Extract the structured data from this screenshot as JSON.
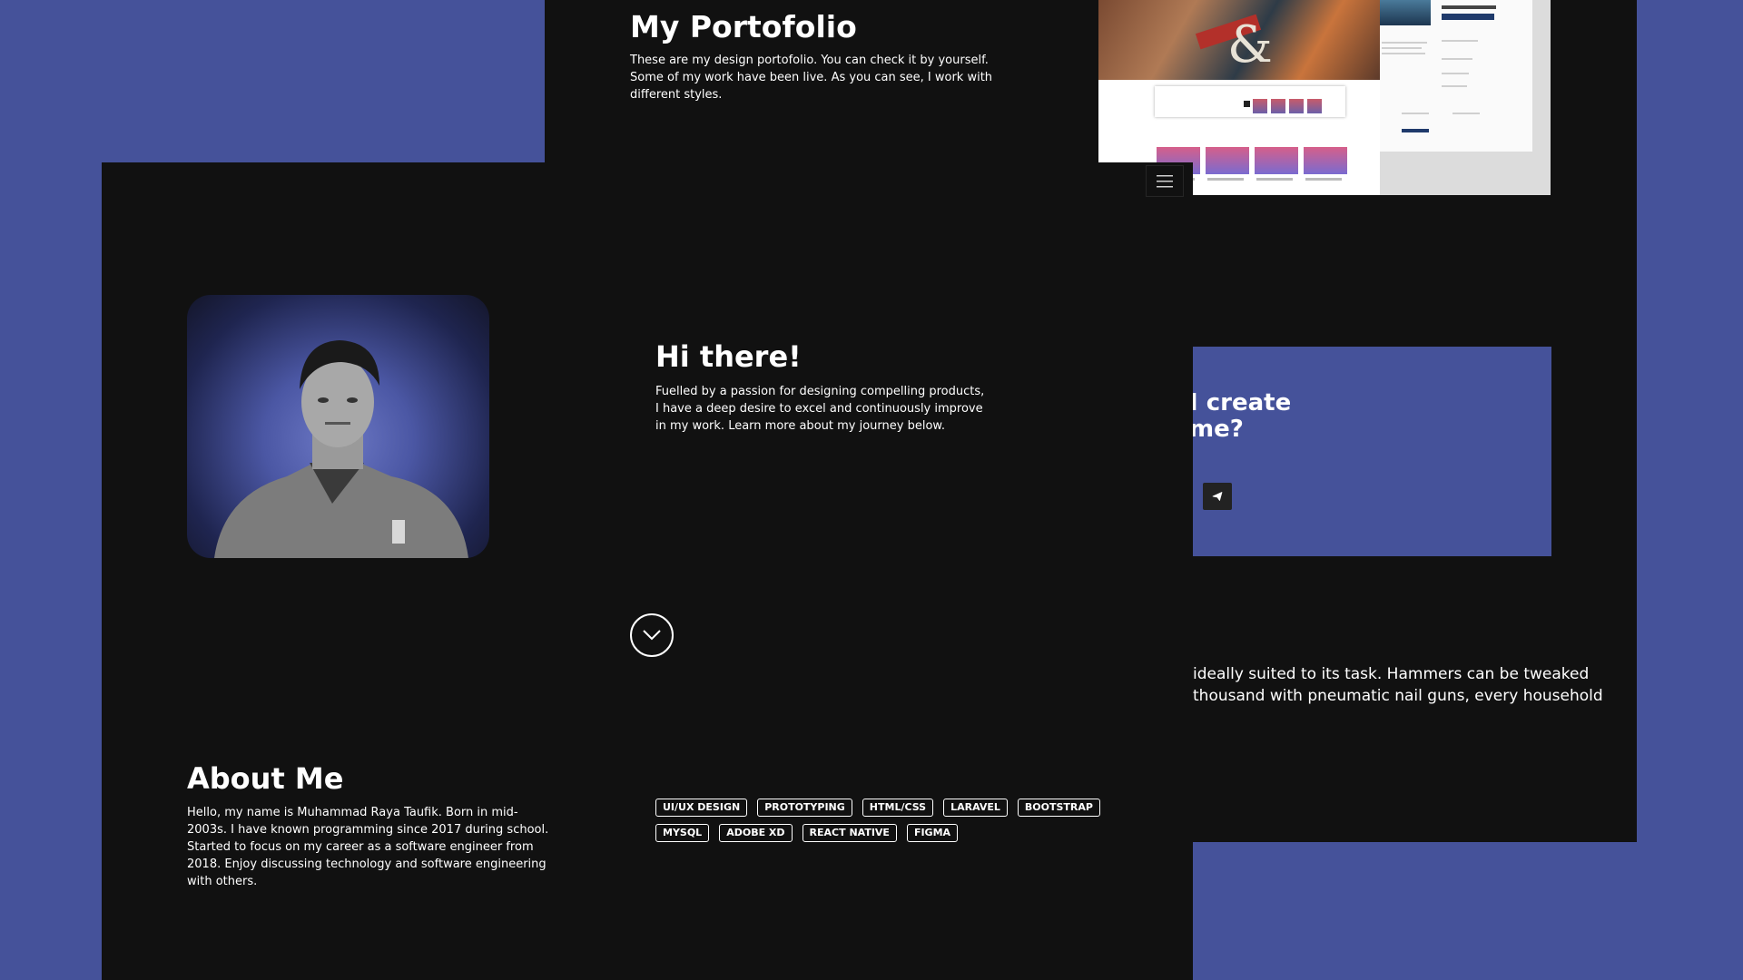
{
  "portfolio": {
    "title": "My Portofolio",
    "description": "These are my design portofolio. You can check it by yourself. Some of my work have been live. As you can see, I work with different styles."
  },
  "contact": {
    "heading": "I create\nme?",
    "send_icon": "paper-plane-icon"
  },
  "tools_text": "ideally suited to its task. Hammers can be tweaked\nthousand with pneumatic nail guns, every household",
  "nav": {
    "menu_icon": "hamburger-menu-icon"
  },
  "hero": {
    "title": "Hi there!",
    "text": "Fuelled by a passion for designing compelling products, I have a deep desire to excel and continuously improve in my work. Learn more about my journey below.",
    "scroll_icon": "chevron-down-icon"
  },
  "about": {
    "title": "About Me",
    "text": "Hello, my name is Muhammad Raya Taufik. Born in mid-2003s. I have known programming since 2017 during school. Started to focus on my career as a software engineer from 2018. Enjoy discussing technology and software engineering with others.",
    "skills": [
      "UI/UX DESIGN",
      "PROTOTYPING",
      "HTML/CSS",
      "LARAVEL",
      "BOOTSTRAP",
      "MYSQL",
      "ADOBE XD",
      "REACT NATIVE",
      "FIGMA"
    ]
  },
  "colors": {
    "background": "#45529a",
    "panel": "#111111",
    "accent": "#45529a"
  }
}
